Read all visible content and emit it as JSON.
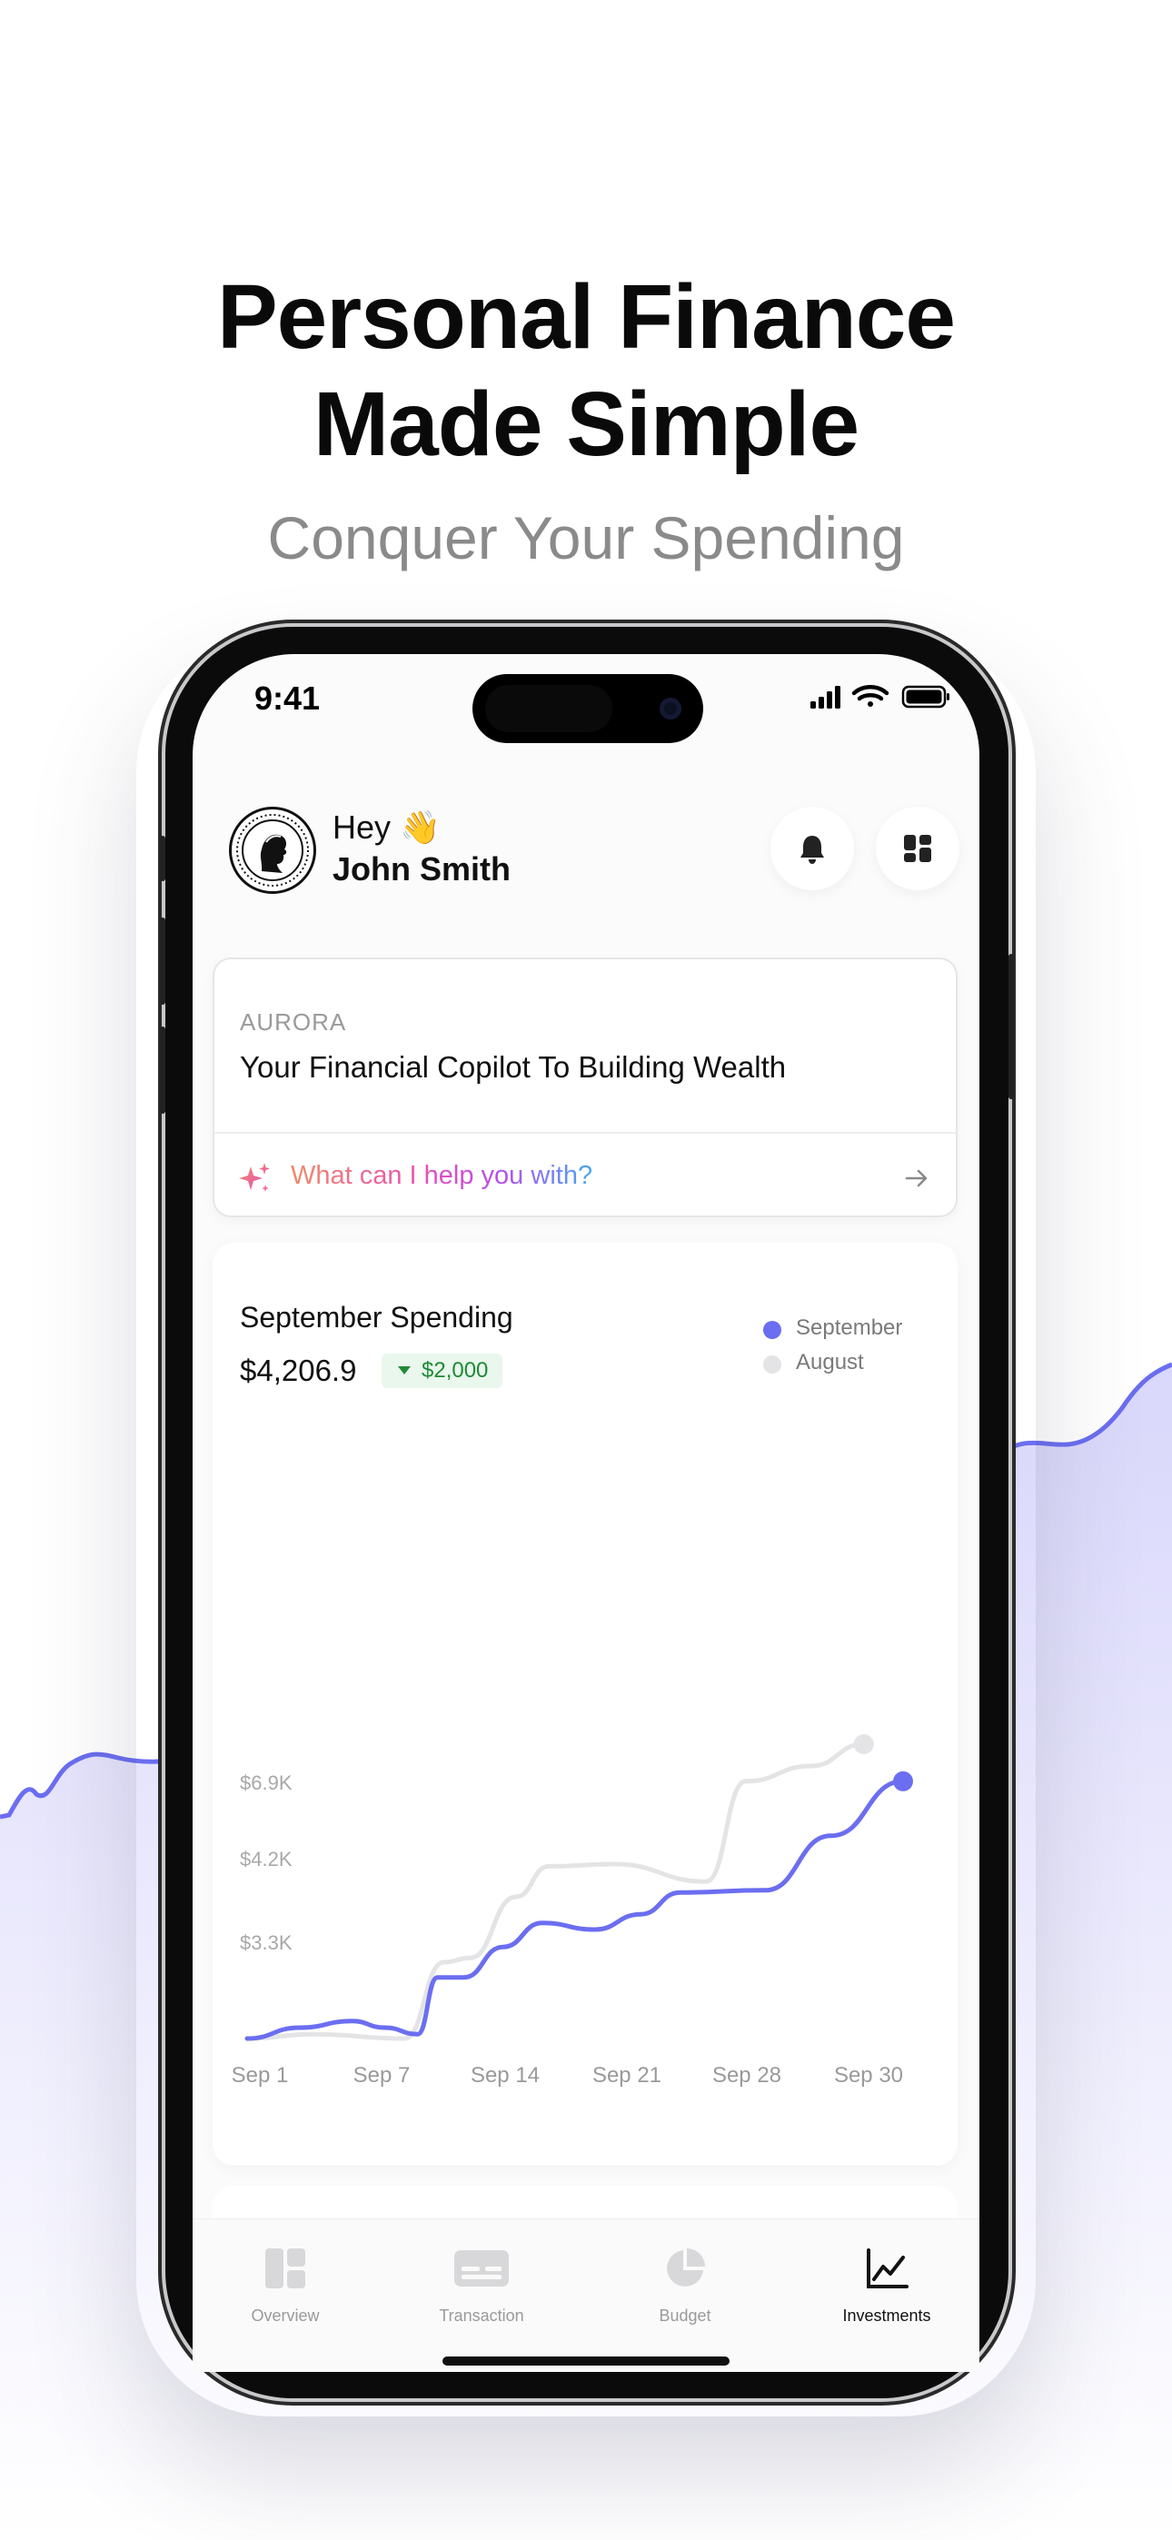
{
  "hero": {
    "headline_line1": "Personal Finance",
    "headline_line2": "Made Simple",
    "subheadline": "Conquer Your Spending"
  },
  "status_bar": {
    "time": "9:41"
  },
  "header": {
    "greeting": "Hey 👋",
    "user_name": "John Smith",
    "icons": [
      "bell-icon",
      "dashboard-grid-icon"
    ]
  },
  "aurora": {
    "label": "AURORA",
    "title": "Your Financial Copilot To Building Wealth",
    "prompt": "What can I help you with?",
    "icons": [
      "sparkle-icon",
      "arrow-right-icon"
    ]
  },
  "spending": {
    "title": "September Spending",
    "amount": "$4,206.9",
    "delta": "$2,000",
    "legend": [
      {
        "label": "September",
        "color": "#6b6ef0"
      },
      {
        "label": "August",
        "color": "#e4e4e6"
      }
    ]
  },
  "chart_data": {
    "type": "line",
    "title": "September Spending",
    "x": [
      "Sep 1",
      "Sep 7",
      "Sep 14",
      "Sep 21",
      "Sep 28",
      "Sep 30"
    ],
    "y_ticks": [
      "$6.9K",
      "$4.2K",
      "$3.3K"
    ],
    "series": [
      {
        "name": "September",
        "color": "#6b6ef0",
        "points": [
          [
            0,
            0.0
          ],
          [
            0.08,
            0.05
          ],
          [
            0.16,
            0.08
          ],
          [
            0.21,
            0.05
          ],
          [
            0.26,
            0.02
          ],
          [
            0.29,
            0.28
          ],
          [
            0.33,
            0.28
          ],
          [
            0.39,
            0.42
          ],
          [
            0.45,
            0.53
          ],
          [
            0.53,
            0.5
          ],
          [
            0.6,
            0.57
          ],
          [
            0.66,
            0.67
          ],
          [
            0.79,
            0.68
          ],
          [
            0.89,
            0.93
          ],
          [
            1.0,
            1.18
          ]
        ]
      },
      {
        "name": "August",
        "color": "#e4e4e6",
        "points": [
          [
            0,
            0.0
          ],
          [
            0.1,
            0.02
          ],
          [
            0.24,
            0.0
          ],
          [
            0.3,
            0.35
          ],
          [
            0.34,
            0.37
          ],
          [
            0.41,
            0.65
          ],
          [
            0.46,
            0.79
          ],
          [
            0.56,
            0.8
          ],
          [
            0.7,
            0.72
          ],
          [
            0.76,
            1.18
          ],
          [
            0.86,
            1.25
          ],
          [
            0.94,
            1.35
          ]
        ]
      }
    ]
  },
  "tabbar": {
    "tabs": [
      {
        "label": "Overview",
        "icon": "overview-icon",
        "active": false
      },
      {
        "label": "Transaction",
        "icon": "transaction-icon",
        "active": false
      },
      {
        "label": "Budget",
        "icon": "budget-pie-icon",
        "active": false
      },
      {
        "label": "Investments",
        "icon": "investments-chart-icon",
        "active": true
      }
    ]
  }
}
